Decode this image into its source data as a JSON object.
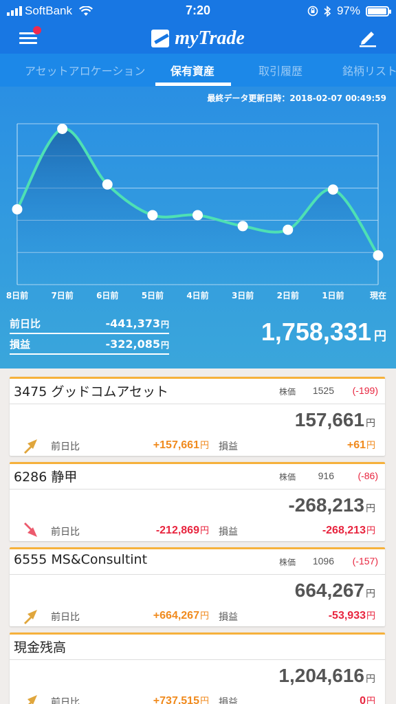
{
  "status_bar": {
    "carrier": "SoftBank",
    "time": "7:20",
    "battery": "97%",
    "battery_level": 0.97
  },
  "header": {
    "app_name": "myTrade"
  },
  "tabs": [
    {
      "label": "アセットアロケーション",
      "active": false
    },
    {
      "label": "保有資産",
      "active": true
    },
    {
      "label": "取引履歴",
      "active": false
    },
    {
      "label": "銘柄リスト",
      "active": false
    }
  ],
  "last_update": "最終データ更新日時：2018-02-07 00:49:59",
  "chart_data": {
    "type": "line",
    "categories": [
      "8日前",
      "7日前",
      "6日前",
      "5日前",
      "4日前",
      "3日前",
      "2日前",
      "1日前",
      "現在"
    ],
    "values": [
      1.93,
      3.03,
      2.27,
      1.85,
      1.85,
      1.7,
      1.65,
      2.2,
      1.3
    ],
    "ylim": [
      0.9,
      3.1
    ],
    "grid": true,
    "colors": {
      "line": "#4ee0b4",
      "point": "#ffffff",
      "grid": "#c8e4f6"
    }
  },
  "summary": {
    "day_change_label": "前日比",
    "day_change_value": "-441,373",
    "pl_label": "損益",
    "pl_value": "-322,085",
    "yen": "円",
    "total": "1,758,331"
  },
  "holdings": [
    {
      "title": "3475 グッドコムアセット",
      "price_label": "株価",
      "price": "1525",
      "change": "(-199)",
      "value": "157,661",
      "direction": "up",
      "diff_label": "前日比",
      "diff": "+157,661",
      "diff_sign": "pos",
      "pl_label": "損益",
      "pl": "+61",
      "pl_sign": "pos"
    },
    {
      "title": "6286 静甲",
      "price_label": "株価",
      "price": "916",
      "change": "(-86)",
      "value": "-268,213",
      "direction": "down",
      "diff_label": "前日比",
      "diff": "-212,869",
      "diff_sign": "neg",
      "pl_label": "損益",
      "pl": "-268,213",
      "pl_sign": "neg"
    },
    {
      "title": "6555 MS&Consultint",
      "price_label": "株価",
      "price": "1096",
      "change": "(-157)",
      "value": "664,267",
      "direction": "up",
      "diff_label": "前日比",
      "diff": "+664,267",
      "diff_sign": "pos",
      "pl_label": "損益",
      "pl": "-53,933",
      "pl_sign": "neg"
    },
    {
      "title": "現金残高",
      "price_label": "",
      "price": "",
      "change": "",
      "value": "1,204,616",
      "direction": "up",
      "diff_label": "前日比",
      "diff": "+737,515",
      "diff_sign": "pos",
      "pl_label": "損益",
      "pl": "0",
      "pl_sign": "neg"
    }
  ],
  "yen": "円"
}
